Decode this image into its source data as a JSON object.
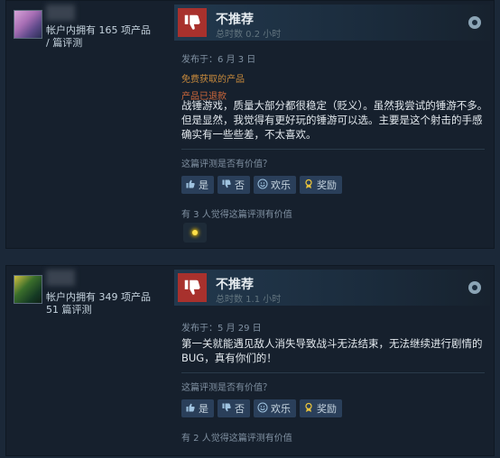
{
  "reviews": [
    {
      "owner_line1": "帐户内拥有 165 项产品",
      "owner_line2": "/ 篇评测",
      "verdict": "不推荐",
      "hours": "总时数 0.2 小时",
      "posted": "发布于：6 月 3 日",
      "free_label": "免费获取的产品",
      "refund_label": "产品已退款",
      "body": "战锤游戏，质量大部分都很稳定（贬义）。虽然我尝试的锤游不多。但是显然，我觉得有更好玩的锤游可以选。主要是这个射击的手感确实有一些些差，不太喜欢。",
      "helpful_question": "这篇评测是否有价值？",
      "buttons": {
        "yes": "是",
        "no": "否",
        "funny": "欢乐",
        "award": "奖励"
      },
      "helpful_count": "有 3 人觉得这篇评测有价值"
    },
    {
      "owner_line1": "帐户内拥有 349 项产品",
      "owner_line2": "51 篇评测",
      "verdict": "不推荐",
      "hours": "总时数 1.1 小时",
      "posted": "发布于：5 月 29 日",
      "body": "第一关就能遇见敌人消失导致战斗无法结束，无法继续进行剧情的BUG，真有你们的！",
      "helpful_question": "这篇评测是否有价值？",
      "buttons": {
        "yes": "是",
        "no": "否",
        "funny": "欢乐",
        "award": "奖励"
      },
      "helpful_count": "有 2 人觉得这篇评测有价值"
    }
  ],
  "colors": {
    "page_bg": "#1b2838",
    "card_bg": "#16202d",
    "thumb_down_bg": "#a8312d",
    "button_bg": "#2a3f5a",
    "free_label": "#c88a3c",
    "refund_label": "#d0683a"
  },
  "icons": {
    "verdict": "thumbs-down-icon",
    "yes": "thumbs-up-icon",
    "no": "thumbs-down-icon",
    "funny": "smiley-icon",
    "award": "award-icon",
    "platform": "steam-icon"
  }
}
